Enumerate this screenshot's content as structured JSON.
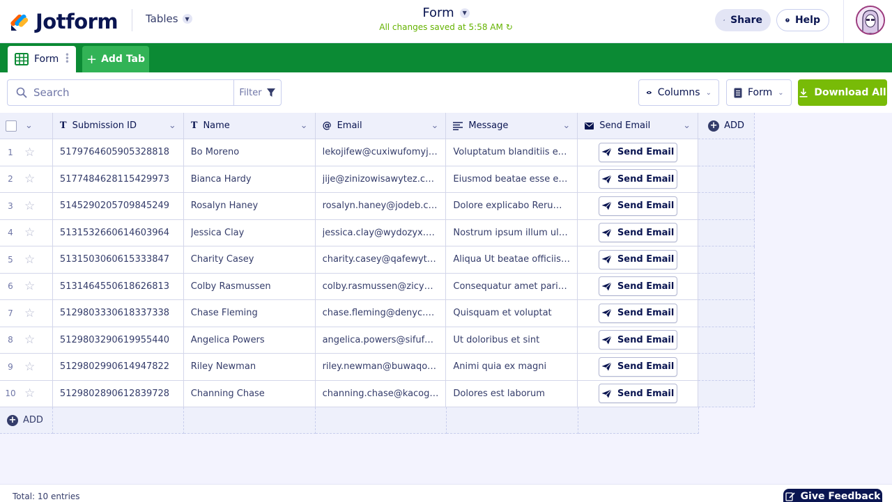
{
  "header": {
    "logo_text": "Jotform",
    "tables_label": "Tables",
    "form_title": "Form",
    "saved_status": "All changes saved at 5:58 AM",
    "share_label": "Share",
    "help_label": "Help"
  },
  "tabs": {
    "form_label": "Form",
    "add_label": "Add Tab"
  },
  "toolbar": {
    "search_placeholder": "Search",
    "filter_label": "Filter",
    "columns_label": "Columns",
    "form_label": "Form",
    "download_label": "Download All"
  },
  "table": {
    "columns": [
      "Submission ID",
      "Name",
      "Email",
      "Message",
      "Send Email"
    ],
    "add_column_label": "ADD",
    "add_row_label": "ADD",
    "send_label": "Send Email",
    "rows": [
      {
        "num": "1",
        "id": "5179764605905328818",
        "name": "Bo Moreno",
        "email": "lekojifew@cuxiwufomyje.c...",
        "message": "Voluptatum blanditiis exce..."
      },
      {
        "num": "2",
        "id": "5177484628115429973",
        "name": "Bianca Hardy",
        "email": "jije@zinizowisawytez.com",
        "message": "Eiusmod beatae esse et co..."
      },
      {
        "num": "3",
        "id": "5145290205709845249",
        "name": "Rosalyn Haney",
        "email": "rosalyn.haney@jodeb.com",
        "message": "Dolore explicabo Rerum n..."
      },
      {
        "num": "4",
        "id": "5131532660614603964",
        "name": "Jessica Clay",
        "email": "jessica.clay@wydozyx.com",
        "message": "Nostrum ipsum illum ullam..."
      },
      {
        "num": "5",
        "id": "5131503060615333847",
        "name": "Charity Casey",
        "email": "charity.casey@qafewytu.c...",
        "message": "Aliqua Ut beatae officiis vi..."
      },
      {
        "num": "6",
        "id": "5131464550618626813",
        "name": "Colby Rasmussen",
        "email": "colby.rasmussen@zicypiky...",
        "message": "Consequatur amet pariatu..."
      },
      {
        "num": "7",
        "id": "5129803330618337338",
        "name": "Chase Fleming",
        "email": "chase.fleming@denyc.com",
        "message": "Quisquam et voluptat"
      },
      {
        "num": "8",
        "id": "5129803290619955440",
        "name": "Angelica Powers",
        "email": "angelica.powers@sifufyxi...",
        "message": "Ut doloribus et sint"
      },
      {
        "num": "9",
        "id": "5129802990614947822",
        "name": "Riley Newman",
        "email": "riley.newman@buwaqo.com",
        "message": "Animi quia ex magni"
      },
      {
        "num": "10",
        "id": "5129802890612839728",
        "name": "Channing Chase",
        "email": "channing.chase@kacogitu...",
        "message": "Dolores est laborum"
      }
    ]
  },
  "footer": {
    "total_label": "Total: 10 entries",
    "feedback_label": "Give Feedback"
  },
  "icons": {
    "column_text": "text-type-icon",
    "column_email": "at-sign-icon",
    "column_message": "paragraph-icon",
    "column_send": "envelope-icon",
    "send_button": "paper-plane-icon"
  },
  "colors": {
    "brand_navy": "#0a1551",
    "tab_bar_green": "#0b8a34",
    "add_tab_green": "#32b356",
    "download_green": "#78bb07",
    "saved_green": "#64b200"
  }
}
